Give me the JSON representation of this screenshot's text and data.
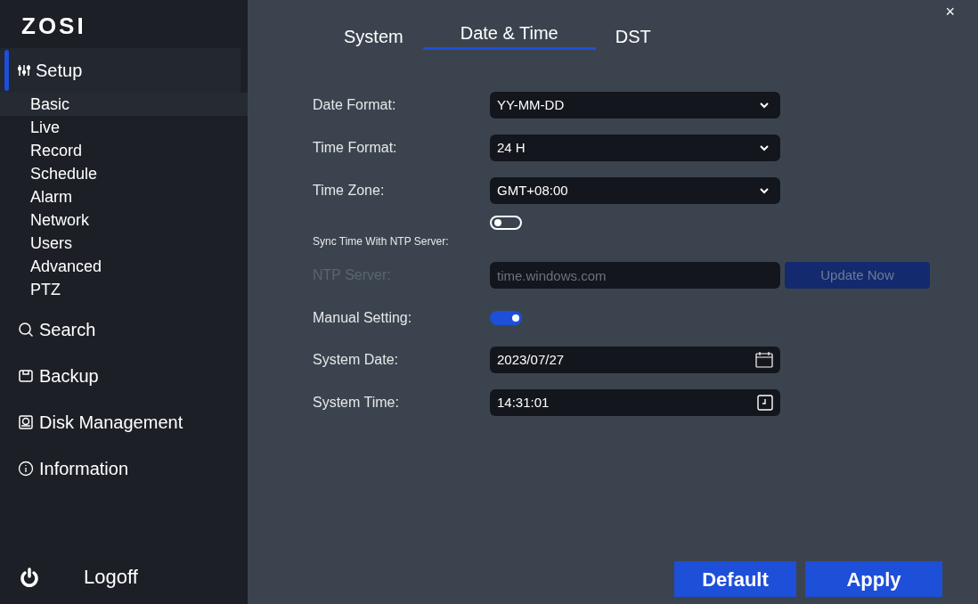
{
  "logo": "ZOSI",
  "sidebar": {
    "items": [
      {
        "label": "Setup",
        "selected": true,
        "children": [
          {
            "label": "Basic",
            "selected": true
          },
          {
            "label": "Live",
            "selected": false
          },
          {
            "label": "Record",
            "selected": false
          },
          {
            "label": "Schedule",
            "selected": false
          },
          {
            "label": "Alarm",
            "selected": false
          },
          {
            "label": "Network",
            "selected": false
          },
          {
            "label": "Users",
            "selected": false
          },
          {
            "label": "Advanced",
            "selected": false
          },
          {
            "label": "PTZ",
            "selected": false
          }
        ]
      },
      {
        "label": "Search",
        "selected": false
      },
      {
        "label": "Backup",
        "selected": false
      },
      {
        "label": "Disk Management",
        "selected": false
      },
      {
        "label": "Information",
        "selected": false
      }
    ],
    "logoff": "Logoff"
  },
  "close": "×",
  "tabs": [
    {
      "label": "System",
      "selected": false
    },
    {
      "label": "Date & Time",
      "selected": true
    },
    {
      "label": "DST",
      "selected": false
    }
  ],
  "fields": [
    {
      "kind": "select",
      "label": "Date Format:",
      "value": "YY-MM-DD",
      "disabled": false
    },
    {
      "kind": "select",
      "label": "Time Format:",
      "value": "24 H",
      "disabled": false
    },
    {
      "kind": "select",
      "label": "Time Zone:",
      "value": "GMT+08:00",
      "disabled": false
    },
    {
      "kind": "toggle",
      "label": "Sync Time With NTP Server:",
      "on": false,
      "disabled": false
    },
    {
      "kind": "text",
      "label": "NTP Server:",
      "value": "time.windows.com",
      "button": "Update Now",
      "disabled": true
    },
    {
      "kind": "toggle",
      "label": "Manual Setting:",
      "on": true,
      "disabled": false
    },
    {
      "kind": "date",
      "label": "System Date:",
      "value": "2023/07/27",
      "disabled": false
    },
    {
      "kind": "time",
      "label": "System Time:",
      "value": "14:31:01",
      "disabled": false
    }
  ],
  "buttons": [
    "Default",
    "Apply"
  ]
}
